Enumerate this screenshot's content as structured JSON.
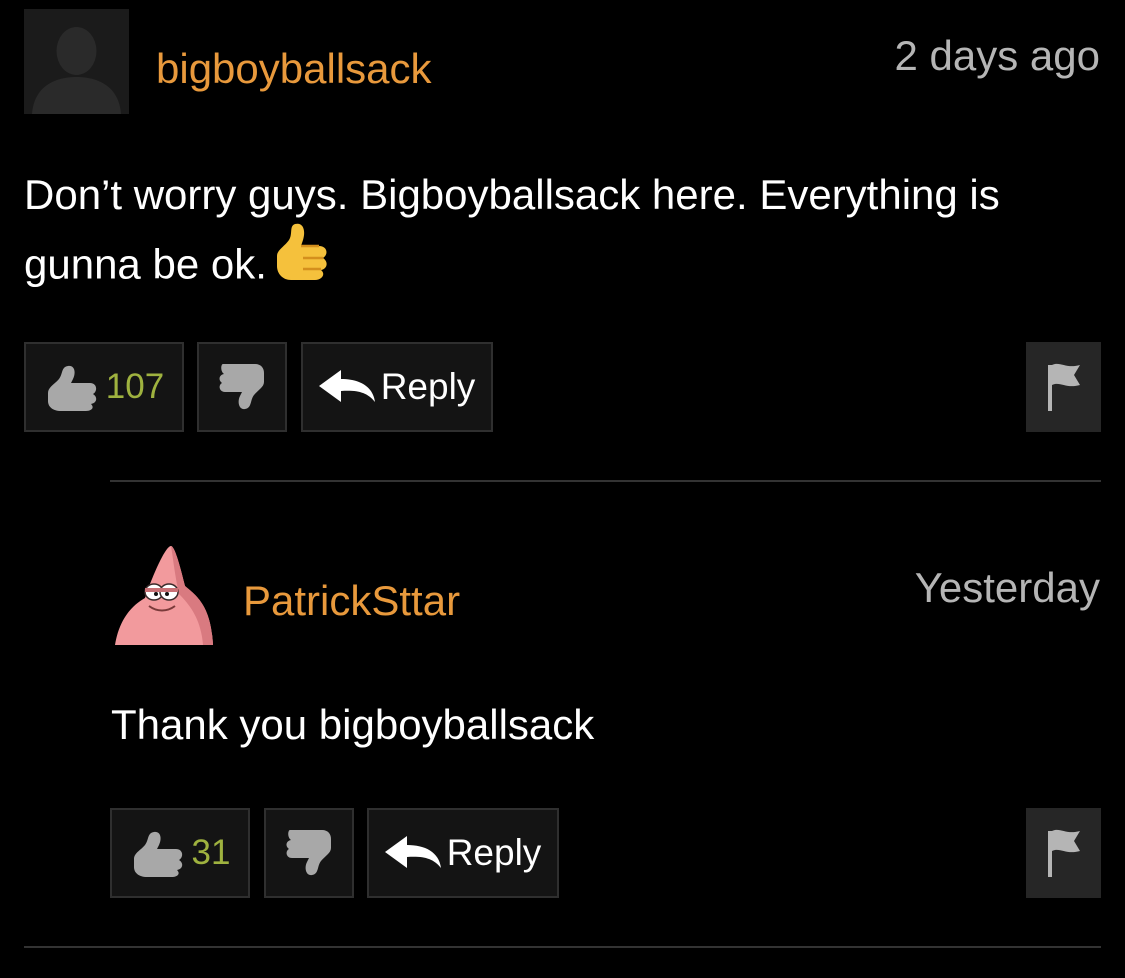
{
  "colors": {
    "background": "#000000",
    "username": "#e8993c",
    "timestamp": "#b5b5b5",
    "vote_count": "#9fb23f",
    "button_bg": "#141414",
    "button_border": "#2f2f2f",
    "flag_bg": "#262626",
    "icon_gray": "#a8a8a8",
    "divider": "#333333"
  },
  "comments": [
    {
      "username": "bigboyballsack",
      "timestamp": "2 days ago",
      "text": "Don’t worry guys. Bigboyballsack here. Everything is gunna be ok.",
      "text_emoji": "thumbs-up-emoji",
      "avatar_icon": "default-user-silhouette-icon",
      "upvotes": "107",
      "reply_label": "Reply",
      "icons": {
        "like": "thumbs-up-icon",
        "dislike": "thumbs-down-icon",
        "reply": "reply-arrow-icon",
        "flag": "flag-icon"
      }
    },
    {
      "username": "PatrickSttar",
      "timestamp": "Yesterday",
      "text": "Thank you bigboyballsack",
      "avatar_icon": "patrick-star-avatar",
      "upvotes": "31",
      "reply_label": "Reply",
      "icons": {
        "like": "thumbs-up-icon",
        "dislike": "thumbs-down-icon",
        "reply": "reply-arrow-icon",
        "flag": "flag-icon"
      }
    }
  ]
}
